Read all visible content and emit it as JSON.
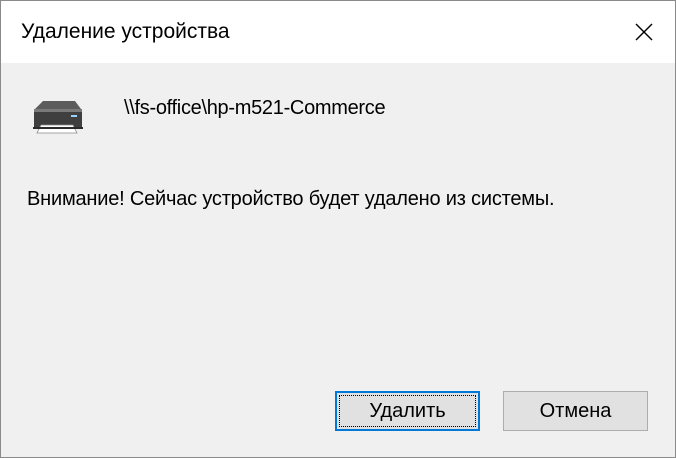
{
  "window": {
    "title": "Удаление устройства",
    "close_icon": "close-icon"
  },
  "device": {
    "icon": "printer-icon",
    "path": "\\\\fs-office\\hp-m521-Commerce"
  },
  "message": "Внимание! Сейчас устройство будет удалено из системы.",
  "buttons": {
    "delete_label": "Удалить",
    "cancel_label": "Отмена"
  },
  "colors": {
    "title_bg": "#ffffff",
    "body_bg": "#f0f0f0",
    "button_bg": "#e1e1e1",
    "focus_accent": "#0078d7"
  }
}
